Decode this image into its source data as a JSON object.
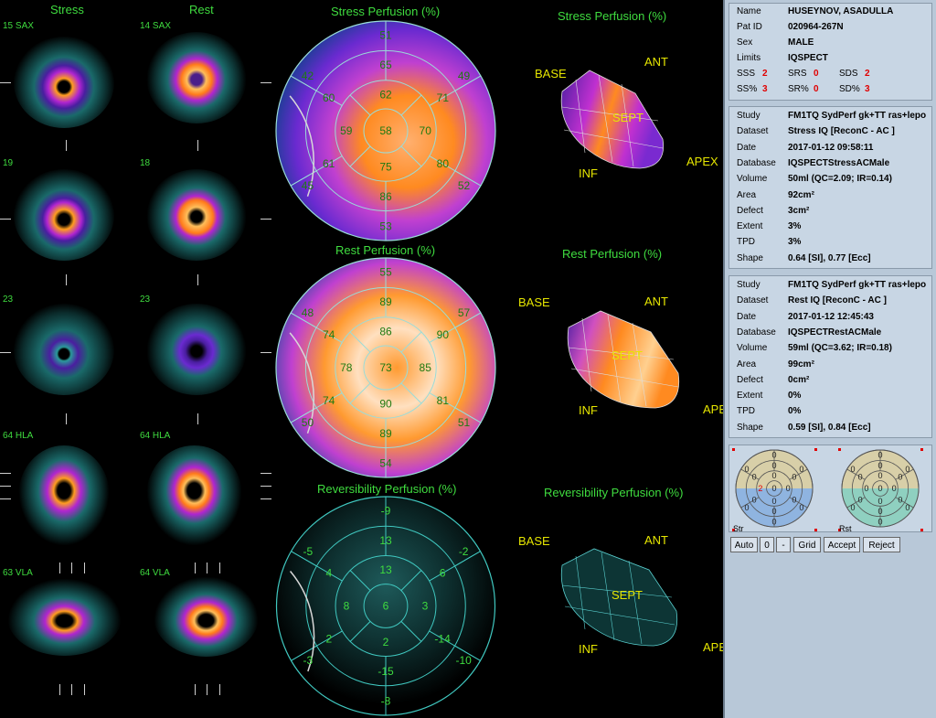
{
  "column_headers": {
    "stress": "Stress",
    "rest": "Rest"
  },
  "slices": [
    {
      "stress_label": "15 SAX",
      "rest_label": "14 SAX"
    },
    {
      "stress_label": "19",
      "rest_label": "18"
    },
    {
      "stress_label": "23",
      "rest_label": "23"
    },
    {
      "stress_label": "64 HLA",
      "rest_label": "64 HLA"
    },
    {
      "stress_label": "63 VLA",
      "rest_label": "64 VLA"
    }
  ],
  "polar_maps": {
    "stress": {
      "title": "Stress Perfusion (%)",
      "values": [
        "51",
        "65",
        "62",
        "71",
        "49",
        "42",
        "60",
        "59",
        "58",
        "70",
        "80",
        "52",
        "45",
        "61",
        "75",
        "86",
        "53"
      ]
    },
    "rest": {
      "title": "Rest Perfusion (%)",
      "values": [
        "55",
        "89",
        "86",
        "90",
        "57",
        "48",
        "74",
        "78",
        "73",
        "85",
        "81",
        "51",
        "50",
        "74",
        "90",
        "89",
        "54"
      ]
    },
    "reversibility": {
      "title": "Reversibility Perfusion (%)",
      "values": [
        "-9",
        "13",
        "13",
        "6",
        "-2",
        "-5",
        "4",
        "8",
        "6",
        "3",
        "-14",
        "-10",
        "-3",
        "2",
        "2",
        "-15",
        "-8"
      ]
    }
  },
  "views_3d": {
    "stress": {
      "title": "Stress Perfusion (%)",
      "base": "BASE",
      "ant": "ANT",
      "sept": "SEPT",
      "inf": "INF",
      "apex": "APEX"
    },
    "rest": {
      "title": "Rest Perfusion (%)",
      "base": "BASE",
      "ant": "ANT",
      "sept": "SEPT",
      "inf": "INF",
      "apex": "APE"
    },
    "reversibility": {
      "title": "Reversibility Perfusion (%)",
      "base": "BASE",
      "ant": "ANT",
      "sept": "SEPT",
      "inf": "INF",
      "apex": "APE"
    }
  },
  "patient": {
    "name_label": "Name",
    "name": "HUSEYNOV, ASADULLA",
    "id_label": "Pat ID",
    "id": "020964-267N",
    "sex_label": "Sex",
    "sex": "MALE",
    "limits_label": "Limits",
    "limits": "IQSPECT",
    "scores": {
      "ssss_label": "SSS",
      "sss": "2",
      "srs_label": "SRS",
      "srs": "0",
      "sds_label": "SDS",
      "sds": "2",
      "ssp_label": "SS%",
      "ssp": "3",
      "srp_label": "SR%",
      "srp": "0",
      "sdp_label": "SD%",
      "sdp": "3"
    }
  },
  "stress_study": {
    "study": "FM1TQ SydPerf gk+TT ras+lepo",
    "dataset": "Stress IQ [ReconC - AC ]",
    "date": "2017-01-12 09:58:11",
    "database": "IQSPECTStressACMale",
    "volume": "50ml (QC=2.09; IR=0.14)",
    "area": "92cm²",
    "defect": "3cm²",
    "extent": "3%",
    "tpd": "3%",
    "shape": "0.64 [SI], 0.77 [Ecc]"
  },
  "rest_study": {
    "study": "FM1TQ SydPerf gk+TT ras+lepo",
    "dataset": "Rest IQ [ReconC - AC ]",
    "date": "2017-01-12 12:45:43",
    "database": "IQSPECTRestACMale",
    "volume": "59ml (QC=3.62; IR=0.18)",
    "area": "99cm²",
    "defect": "0cm²",
    "extent": "0%",
    "tpd": "0%",
    "shape": "0.59 [SI], 0.84 [Ecc]"
  },
  "field_labels": {
    "study": "Study",
    "dataset": "Dataset",
    "date": "Date",
    "database": "Database",
    "volume": "Volume",
    "area": "Area",
    "defect": "Defect",
    "extent": "Extent",
    "tpd": "TPD",
    "shape": "Shape"
  },
  "mini_maps": {
    "stress_label": "Str",
    "rest_label": "Rst",
    "stress_values": [
      "0",
      "0",
      "0",
      "0",
      "0",
      "0",
      "0",
      "2",
      "0",
      "0",
      "0",
      "0",
      "0",
      "0",
      "0",
      "0",
      "0"
    ],
    "rest_values": [
      "0",
      "0",
      "0",
      "0",
      "0",
      "0",
      "0",
      "0",
      "0",
      "0",
      "0",
      "0",
      "0",
      "0",
      "0",
      "0",
      "0"
    ]
  },
  "buttons": {
    "auto": "Auto",
    "zero": "0",
    "minus": "-",
    "grid": "Grid",
    "accept": "Accept",
    "reject": "Reject"
  },
  "colors": {
    "label_green": "#3fdc3f",
    "label_yellow": "#e6e600",
    "panel_bg": "#b8c8d8",
    "score_red": "#e00000"
  }
}
